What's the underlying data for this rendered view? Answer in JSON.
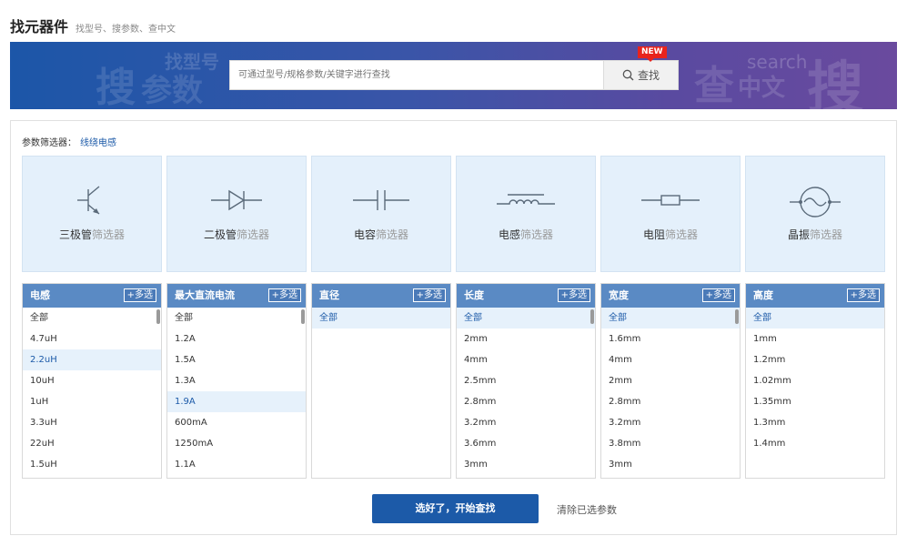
{
  "header": {
    "title": "找元器件",
    "subtitle": "找型号、搜参数、查中文"
  },
  "banner": {
    "watermarks": [
      "找型号",
      "搜",
      "参数",
      "查",
      "search",
      "中文",
      "搜"
    ],
    "search_placeholder": "可通过型号/规格参数/关键字进行查找",
    "search_button": "查找",
    "new_badge": "NEW"
  },
  "filter": {
    "label": "参数筛选器：",
    "current": "线绕电感",
    "categories": [
      {
        "name": "三极管",
        "suffix": "筛选器",
        "icon": "transistor-icon"
      },
      {
        "name": "二极管",
        "suffix": "筛选器",
        "icon": "diode-icon"
      },
      {
        "name": "电容",
        "suffix": "筛选器",
        "icon": "capacitor-icon"
      },
      {
        "name": "电感",
        "suffix": "筛选器",
        "icon": "inductor-icon"
      },
      {
        "name": "电阻",
        "suffix": "筛选器",
        "icon": "resistor-icon"
      },
      {
        "name": "晶振",
        "suffix": "筛选器",
        "icon": "crystal-icon"
      }
    ],
    "multi_label": "+多选",
    "columns": [
      {
        "title": "电感",
        "items": [
          "全部",
          "4.7uH",
          "2.2uH",
          "10uH",
          "1uH",
          "3.3uH",
          "22uH",
          "1.5uH"
        ],
        "selected": 2
      },
      {
        "title": "最大直流电流",
        "items": [
          "全部",
          "1.2A",
          "1.5A",
          "1.3A",
          "1.9A",
          "600mA",
          "1250mA",
          "1.1A"
        ],
        "selected": 4
      },
      {
        "title": "直径",
        "items": [
          "全部"
        ],
        "selected": 0
      },
      {
        "title": "长度",
        "items": [
          "全部",
          "2mm",
          "4mm",
          "2.5mm",
          "2.8mm",
          "3.2mm",
          "3.6mm",
          "3mm"
        ],
        "selected": 0
      },
      {
        "title": "宽度",
        "items": [
          "全部",
          "1.6mm",
          "4mm",
          "2mm",
          "2.8mm",
          "3.2mm",
          "3.8mm",
          "3mm"
        ],
        "selected": 0
      },
      {
        "title": "高度",
        "items": [
          "全部",
          "1mm",
          "1.2mm",
          "1.02mm",
          "1.35mm",
          "1.3mm",
          "1.4mm"
        ],
        "selected": 0
      }
    ],
    "submit": "选好了，开始查找",
    "clear": "清除已选参数"
  },
  "colors": {
    "primary": "#1c5aa8",
    "column_header": "#5a8ac4",
    "category_bg": "#e4f0fb",
    "badge": "#e8231d"
  }
}
